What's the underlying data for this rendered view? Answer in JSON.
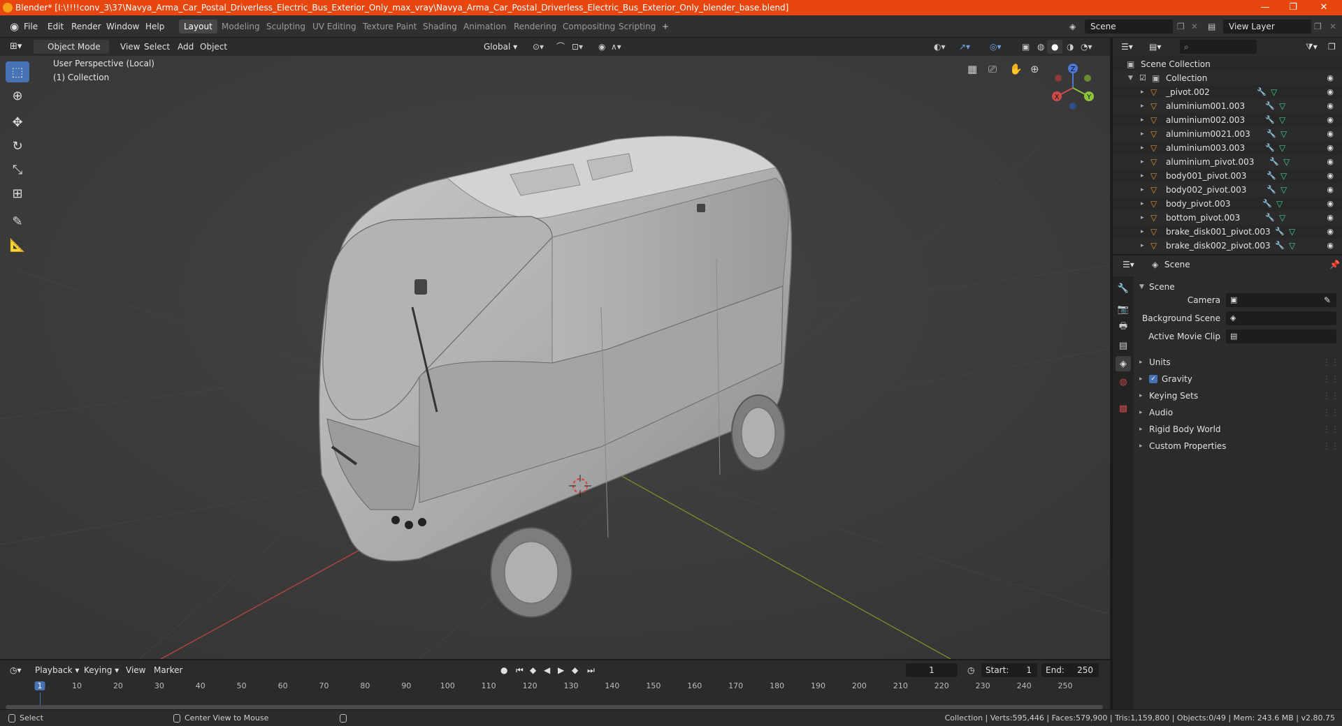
{
  "titlebar": {
    "title": "Blender* [I:\\!!!!conv_3\\37\\Navya_Arma_Car_Postal_Driverless_Electric_Bus_Exterior_Only_max_vray\\Navya_Arma_Car_Postal_Driverless_Electric_Bus_Exterior_Only_blender_base.blend]",
    "minimize": "—",
    "maximize": "❐",
    "close": "✕"
  },
  "menubar": {
    "items": [
      "File",
      "Edit",
      "Render",
      "Window",
      "Help"
    ],
    "workspaces": [
      "Layout",
      "Modeling",
      "Sculpting",
      "UV Editing",
      "Texture Paint",
      "Shading",
      "Animation",
      "Rendering",
      "Compositing",
      "Scripting"
    ],
    "add_workspace": "+",
    "scene": "Scene",
    "view_layer": "View Layer"
  },
  "viewport_header": {
    "mode": "Object Mode",
    "menus": [
      "View",
      "Select",
      "Add",
      "Object"
    ],
    "orientation": "Global"
  },
  "viewport": {
    "perspective": "User Perspective (Local)",
    "collection": "(1) Collection",
    "gizmo": {
      "x": "X",
      "y": "Y",
      "z": "Z"
    }
  },
  "outliner": {
    "root": "Scene Collection",
    "collection": "Collection",
    "objects": [
      "_pivot.002",
      "aluminium001.003",
      "aluminium002.003",
      "aluminium0021.003",
      "aluminium003.003",
      "aluminium_pivot.003",
      "body001_pivot.003",
      "body002_pivot.003",
      "body_pivot.003",
      "bottom_pivot.003",
      "brake_disk001_pivot.003",
      "brake_disk002_pivot.003"
    ]
  },
  "properties": {
    "header": "Scene",
    "panel_title": "Scene",
    "fields": [
      {
        "label": "Camera",
        "value": ""
      },
      {
        "label": "Background Scene",
        "value": ""
      },
      {
        "label": "Active Movie Clip",
        "value": ""
      }
    ],
    "sections": [
      "Units",
      "Gravity",
      "Keying Sets",
      "Audio",
      "Rigid Body World",
      "Custom Properties"
    ],
    "gravity_checked": true
  },
  "timeline": {
    "menus": [
      "Playback",
      "Keying",
      "View",
      "Marker"
    ],
    "current_frame": "1",
    "start_label": "Start:",
    "start": "1",
    "end_label": "End:",
    "end": "250",
    "ticks": [
      "1",
      "10",
      "20",
      "30",
      "40",
      "50",
      "60",
      "70",
      "80",
      "90",
      "100",
      "110",
      "120",
      "130",
      "140",
      "150",
      "160",
      "170",
      "180",
      "190",
      "200",
      "210",
      "220",
      "230",
      "240",
      "250"
    ]
  },
  "statusbar": {
    "left": "Select",
    "middle": "Center View to Mouse",
    "stats": "Collection | Verts:595,446 | Faces:579,900 | Tris:1,159,800 | Objects:0/49 | Mem: 243.6 MB | v2.80.75"
  }
}
